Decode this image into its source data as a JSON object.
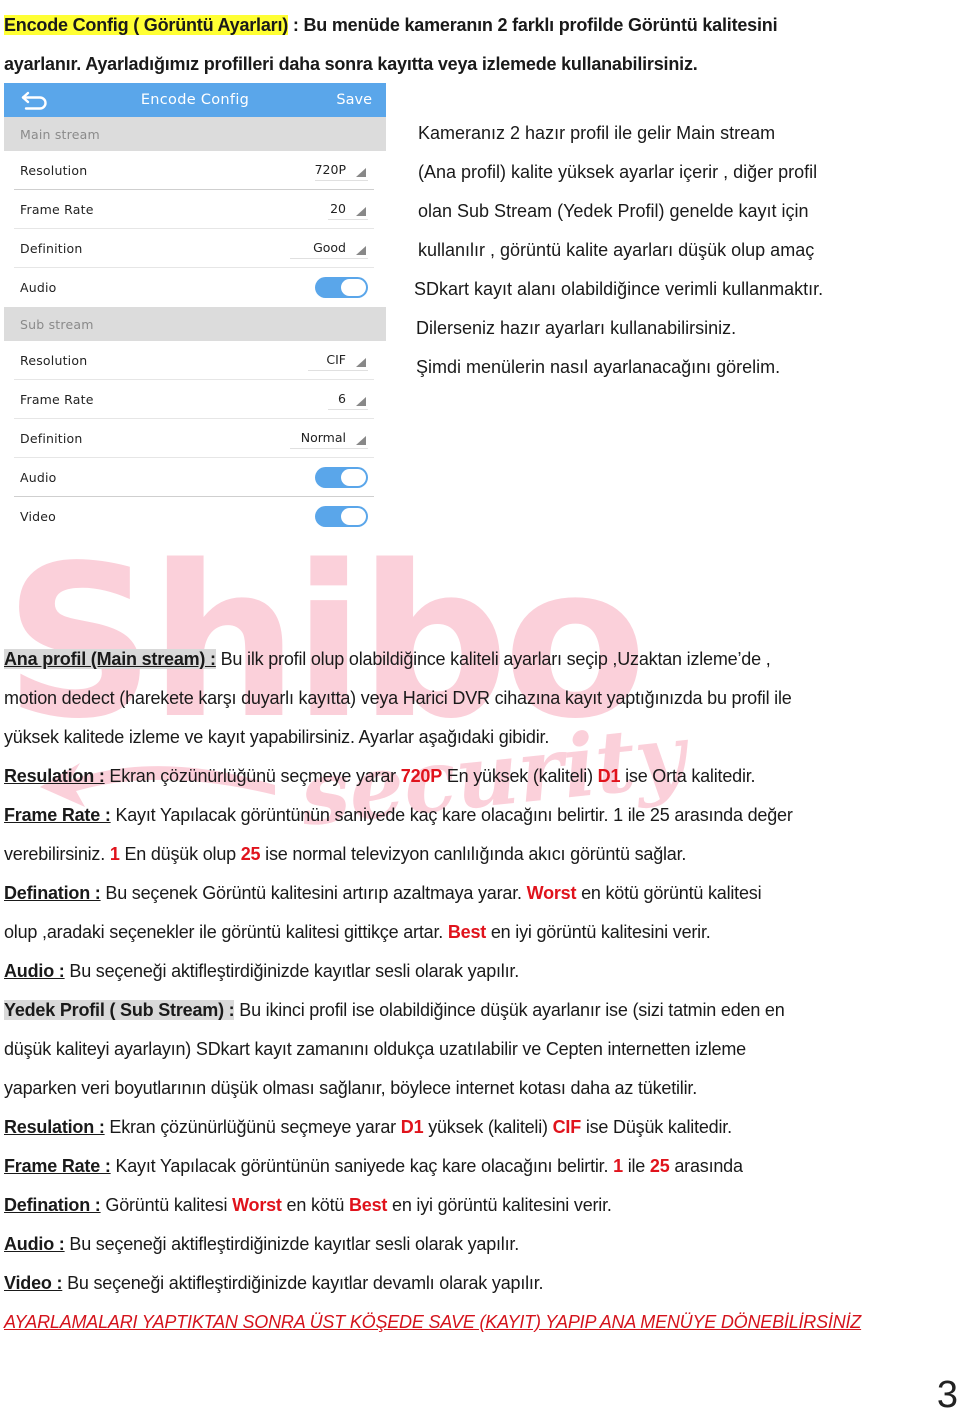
{
  "intro": {
    "heading": "Encode Config ( Görüntü Ayarları)",
    "line1_rest": " : Bu menüde kameranın 2 farklı profilde Görüntü kalitesini",
    "line2": "ayarlanır. Ayarladığımız profilleri daha sonra kayıtta veya izlemede kullanabilirsiniz."
  },
  "phone": {
    "title": "Encode Config",
    "back_icon": "back-arrow-icon",
    "save_label": "Save",
    "accent_color": "#5aa6ea",
    "main_stream": {
      "header": "Main stream",
      "resolution": {
        "label": "Resolution",
        "value": "720P"
      },
      "frame_rate": {
        "label": "Frame Rate",
        "value": "20"
      },
      "definition": {
        "label": "Definition",
        "value": "Good"
      },
      "audio": {
        "label": "Audio",
        "enabled": true
      }
    },
    "sub_stream": {
      "header": "Sub stream",
      "resolution": {
        "label": "Resolution",
        "value": "CIF"
      },
      "frame_rate": {
        "label": "Frame Rate",
        "value": "6"
      },
      "definition": {
        "label": "Definition",
        "value": "Normal"
      },
      "audio": {
        "label": "Audio",
        "enabled": true
      },
      "video": {
        "label": "Video",
        "enabled": true
      }
    }
  },
  "side": [
    "Kameranız 2 hazır profil ile gelir Main stream",
    "(Ana profil) kalite yüksek ayarlar içerir , diğer profil",
    "olan Sub Stream (Yedek Profil) genelde kayıt için",
    "kullanılır , görüntü kalite ayarları düşük olup amaç",
    "SDkart kayıt  alanı olabildiğince verimli kullanmaktır.",
    "Dilerseniz hazır ayarları kullanabilirsiniz.",
    "Şimdi menülerin nasıl ayarlanacağını görelim."
  ],
  "watermark": {
    "brand": "Shibo",
    "sub": "security"
  },
  "main_profile": {
    "heading": "Ana profil  (Main stream) :",
    "line1": " Bu ilk profil olup olabildiğince kaliteli ayarları seçip ,Uzaktan  izleme’de ,",
    "line2": "motion dedect (harekete karşı duyarlı kayıtta) veya Harici DVR cihazına kayıt yaptığınızda bu profil ile",
    "line3": "yüksek kalitede izleme ve kayıt yapabilirsiniz.  Ayarlar aşağıdaki gibidir.",
    "resolution": {
      "label": "Resulation :",
      "t1": " Ekran çözünürlüğünü seçmeye yarar ",
      "r1": "720P",
      "t2": " En yüksek (kaliteli) ",
      "r2": "D1",
      "t3": " ise Orta kalitedir."
    },
    "frame_rate": {
      "label": "Frame Rate :",
      "t1": " Kayıt Yapılacak görüntünün saniyede kaç kare olacağını belirtir. 1 ile 25 arasında değer",
      "t2": "verebilirsiniz. ",
      "r1": "1",
      "t3": " En düşük olup ",
      "r2": "25",
      "t4": " ise normal televizyon canlılığında akıcı görüntü sağlar."
    },
    "definition": {
      "label": "Defination :",
      "t1": " Bu seçenek Görüntü kalitesini artırıp azaltmaya yarar. ",
      "r1": "Worst",
      "t2": " en kötü görüntü kalitesi",
      "t3": "olup ,aradaki seçenekler ile görüntü kalitesi gittikçe artar. ",
      "r2": "Best",
      "t4": " en iyi görüntü kalitesini verir."
    },
    "audio": {
      "label": "Audio :",
      "t1": " Bu seçeneği aktifleştirdiğinizde kayıtlar sesli olarak yapılır."
    }
  },
  "sub_profile": {
    "heading": "Yedek Profil ( Sub Stream) :",
    "line1": " Bu ikinci profil ise olabildiğince düşük ayarlanır ise  (sizi tatmin eden en",
    "line2": "düşük kaliteyi ayarlayın)  SDkart kayıt zamanını oldukça uzatılabilir ve Cepten internetten izleme",
    "line3": "yaparken veri boyutlarının düşük olması sağlanır, böylece internet kotası daha az tüketilir.",
    "resolution": {
      "label": "Resulation :",
      "t1": " Ekran çözünürlüğünü seçmeye yarar ",
      "r1": "D1",
      "t2": " yüksek (kaliteli) ",
      "r2": "CIF",
      "t3": " ise Düşük kalitedir."
    },
    "frame_rate": {
      "label": "Frame Rate :",
      "t1": " Kayıt Yapılacak görüntünün saniyede kaç kare olacağını belirtir. ",
      "r1": "1",
      "t2": " ile ",
      "r2": "25",
      "t3": " arasında"
    },
    "definition": {
      "label": "Defination :",
      "t1": " Görüntü kalitesi ",
      "r1": "Worst",
      "t2": " en kötü ",
      "r2": "Best",
      "t3": " en iyi görüntü kalitesini verir."
    },
    "audio": {
      "label": "Audio :",
      "t1": " Bu seçeneği aktifleştirdiğinizde kayıtlar sesli olarak yapılır."
    },
    "video": {
      "label": "Video :",
      "t1": " Bu seçeneği aktifleştirdiğinizde kayıtlar devamlı olarak yapılır."
    }
  },
  "warning": "AYARLAMALARI YAPTIKTAN SONRA ÜST KÖŞEDE SAVE (KAYIT) YAPIP ANA MENÜYE DÖNEBİLİRSİNİZ",
  "page_number": "3",
  "colors": {
    "highlight_yellow": "#ffff33",
    "highlight_gray": "#d9d9d9",
    "emphasis_red": "#e0131c",
    "watermark_pink": "#fbd0da"
  }
}
